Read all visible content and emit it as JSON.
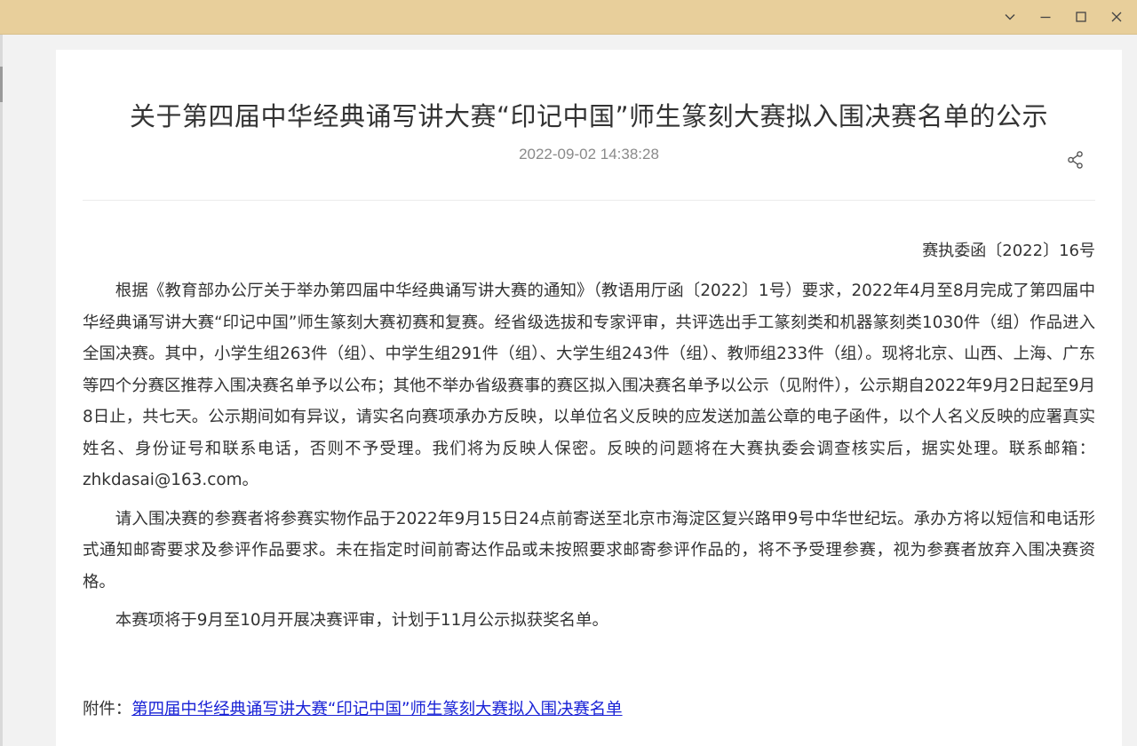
{
  "window": {
    "controls": {
      "dropdown_icon": "chevron-down-icon",
      "minimize_icon": "minimize-icon",
      "maximize_icon": "maximize-icon",
      "close_icon": "close-icon"
    },
    "titlebar_color": "#e8cf9b"
  },
  "article": {
    "title": "关于第四届中华经典诵写讲大赛“印记中国”师生篆刻大赛拟入围决赛名单的公示",
    "date": "2022-09-02 14:38:28",
    "share_icon": "share-icon",
    "doc_number": "赛执委函〔2022〕16号",
    "paragraphs": [
      "根据《教育部办公厅关于举办第四届中华经典诵写讲大赛的通知》（教语用厅函〔2022〕1号）要求，2022年4月至8月完成了第四届中华经典诵写讲大赛“印记中国”师生篆刻大赛初赛和复赛。经省级选拔和专家评审，共评选出手工篆刻类和机器篆刻类1030件（组）作品进入全国决赛。其中，小学生组263件（组）、中学生组291件（组）、大学生组243件（组）、教师组233件（组）。现将北京、山西、上海、广东等四个分赛区推荐入围决赛名单予以公布；其他不举办省级赛事的赛区拟入围决赛名单予以公示（见附件），公示期自2022年9月2日起至9月8日止，共七天。公示期间如有异议，请实名向赛项承办方反映，以单位名义反映的应发送加盖公章的电子函件，以个人名义反映的应署真实姓名、身份证号和联系电话，否则不予受理。我们将为反映人保密。反映的问题将在大赛执委会调查核实后，据实处理。联系邮箱：zhkdasai@163.com。",
      "请入围决赛的参赛者将参赛实物作品于2022年9月15日24点前寄送至北京市海淀区复兴路甲9号中华世纪坛。承办方将以短信和电话形式通知邮寄要求及参评作品要求。未在指定时间前寄达作品或未按照要求邮寄参评作品的，将不予受理参赛，视为参赛者放弃入围决赛资格。",
      "本赛项将于9月至10月开展决赛评审，计划于11月公示拟获奖名单。"
    ],
    "attachment_label": "附件：",
    "attachment_link": "第四届中华经典诵写讲大赛“印记中国”师生篆刻大赛拟入围决赛名单",
    "link_color": "#1a23d6"
  }
}
